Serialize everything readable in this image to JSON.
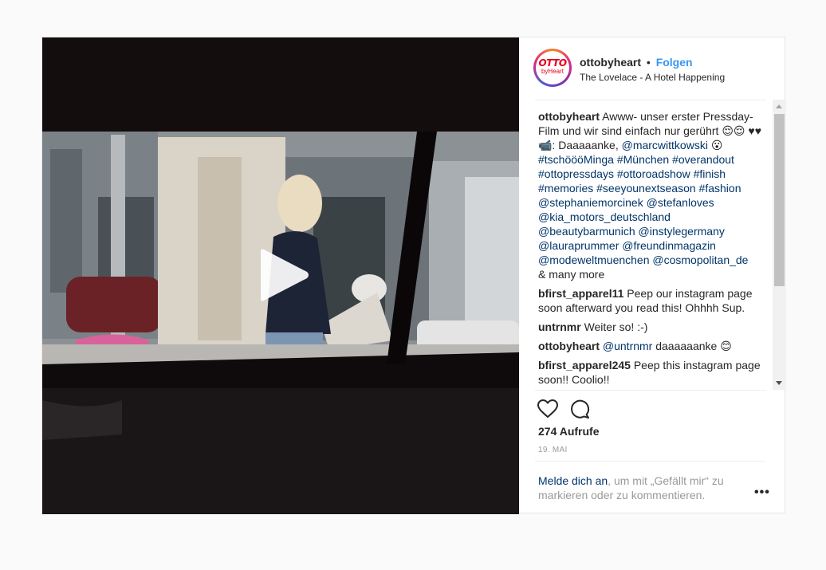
{
  "post": {
    "username": "ottobyheart",
    "separator": "•",
    "follow_label": "Folgen",
    "location": "The Lovelace - A Hotel Happening",
    "avatar_text_main": "OTTO",
    "avatar_text_sub": "byHeart"
  },
  "caption": {
    "username": "ottobyheart",
    "lines": [
      "Awww- unser erster Pressday-",
      "Film und wir sind einfach nur gerührt 😌😌",
      "♥♥ 📹: Daaaaanke, "
    ],
    "mention1": "@marcwittkowski",
    "emoji1": " 😮",
    "hashtags": [
      "#tschöööMinga #München #overandout",
      "#ottopressdays #ottoroadshow #finish",
      "#memories #seeyounextseason #fashion",
      "@stephaniemorcinek @stefanloves",
      "@kia_motors_deutschland",
      "@beautybarmunich @instylegermany",
      "@lauraprummer @freundinmagazin",
      "@modeweltmuenchen @cosmopolitan_de"
    ],
    "tail": "& many more"
  },
  "comments": [
    {
      "user": "bfirst_apparel11",
      "text": "Peep our instagram page soon afterward you read this! Ohhhh Sup."
    },
    {
      "user": "untrnmr",
      "text": "Weiter so! :-)"
    },
    {
      "user": "ottobyheart",
      "mention": "@untrnmr",
      "text": " daaaaaanke 😊"
    },
    {
      "user": "bfirst_apparel245",
      "text": "Peep this instagram page soon!! Coolio!!"
    }
  ],
  "stats": {
    "views": "274 Aufrufe",
    "date": "19. MAI"
  },
  "login": {
    "link": "Melde dich an",
    "text": ", um mit „Gefällt mir“ zu markieren oder zu kommentieren.",
    "more": "•••"
  },
  "icons": {
    "play": "play-icon",
    "like": "heart-icon",
    "comment": "comment-icon"
  }
}
